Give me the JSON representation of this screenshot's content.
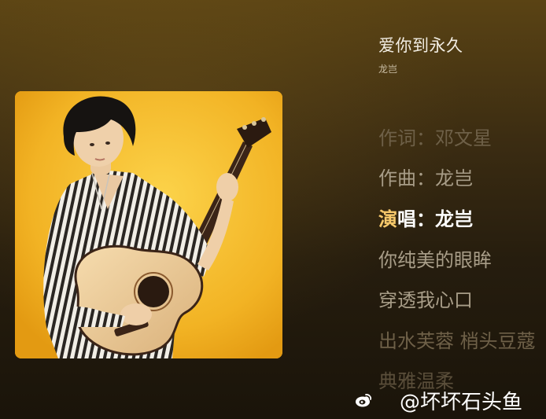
{
  "song": {
    "title": "爱你到永久",
    "artist": "龙岂"
  },
  "lyrics": {
    "lines": [
      "作词：邓文星",
      "作曲：龙岂",
      "你纯美的眼眸",
      "穿透我心口",
      "出水芙蓉 梢头豆蔻",
      "典雅温柔"
    ],
    "active_highlight": "演",
    "active_rest": "唱：龙岂"
  },
  "watermark": {
    "text": "@坏坏石头鱼",
    "icon": "weibo-icon"
  },
  "colors": {
    "background_top": "#5a4314",
    "background_bottom": "#1a140a",
    "cover_background": "#efb020",
    "active_lyric": "#ffffff",
    "active_highlight": "#f7c96b",
    "inactive_lyric": "#a89d88"
  }
}
